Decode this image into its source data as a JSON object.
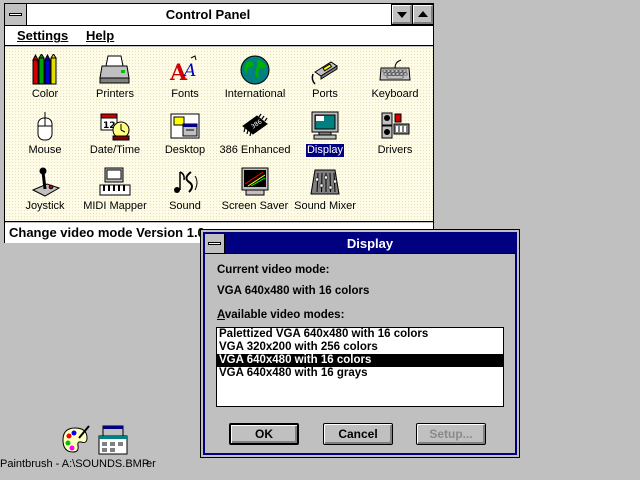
{
  "control_panel": {
    "title": "Control Panel",
    "menu": [
      "Settings",
      "Help"
    ],
    "icons": [
      {
        "label": "Color",
        "icon": "color-icon"
      },
      {
        "label": "Printers",
        "icon": "printer-icon"
      },
      {
        "label": "Fonts",
        "icon": "fonts-icon"
      },
      {
        "label": "International",
        "icon": "globe-icon"
      },
      {
        "label": "Ports",
        "icon": "ports-icon"
      },
      {
        "label": "Keyboard",
        "icon": "keyboard-icon"
      },
      {
        "label": "Mouse",
        "icon": "mouse-icon"
      },
      {
        "label": "Date/Time",
        "icon": "calendar-clock-icon"
      },
      {
        "label": "Desktop",
        "icon": "desktop-icon"
      },
      {
        "label": "386 Enhanced",
        "icon": "chip-icon"
      },
      {
        "label": "Display",
        "icon": "monitor-icon",
        "selected": true
      },
      {
        "label": "Drivers",
        "icon": "drivers-icon"
      },
      {
        "label": "Joystick",
        "icon": "joystick-icon"
      },
      {
        "label": "MIDI Mapper",
        "icon": "midi-icon"
      },
      {
        "label": "Sound",
        "icon": "sound-icon"
      },
      {
        "label": "Screen Saver",
        "icon": "screen-saver-icon"
      },
      {
        "label": "Sound Mixer",
        "icon": "mixer-icon"
      }
    ],
    "status": "Change video mode Version 1.0"
  },
  "display_dialog": {
    "title": "Display",
    "current_label": "Current video mode:",
    "current_value": "VGA 640x480 with 16 colors",
    "available_label": "Available video modes:",
    "modes": [
      "Palettized VGA 640x480 with 16 colors",
      "VGA 320x200 with 256 colors",
      "VGA 640x480 with 16 colors",
      "VGA 640x480 with 16 grays"
    ],
    "selected_index": 2,
    "buttons": {
      "ok": "OK",
      "cancel": "Cancel",
      "setup": "Setup..."
    }
  },
  "desktop": {
    "icons": [
      {
        "label": "Paintbrush - A:\\SOUNDS.BMP",
        "icon": "paintbrush-icon"
      },
      {
        "label": "er",
        "icon": "program-manager-icon"
      }
    ]
  },
  "colors": {
    "desktop": "#c0c0c0",
    "icon_area": "#fefce8",
    "active_title": "#000080",
    "selection": "#000080"
  }
}
